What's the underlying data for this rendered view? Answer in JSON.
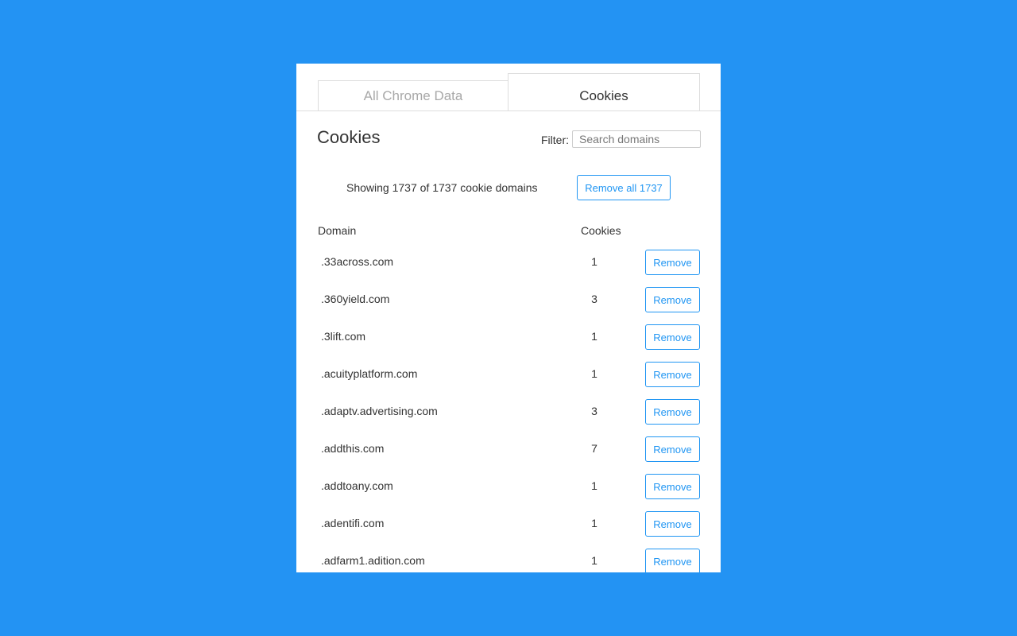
{
  "tabs": [
    {
      "label": "All Chrome Data",
      "active": false
    },
    {
      "label": "Cookies",
      "active": true
    }
  ],
  "header": {
    "title": "Cookies",
    "filter_label": "Filter:",
    "filter_placeholder": "Search domains",
    "filter_value": ""
  },
  "summary": {
    "text": "Showing 1737 of 1737 cookie domains",
    "remove_all_label": "Remove all 1737"
  },
  "table": {
    "columns": [
      "Domain",
      "Cookies"
    ],
    "remove_label": "Remove",
    "rows": [
      {
        "domain": ".33across.com",
        "count": "1"
      },
      {
        "domain": ".360yield.com",
        "count": "3"
      },
      {
        "domain": ".3lift.com",
        "count": "1"
      },
      {
        "domain": ".acuityplatform.com",
        "count": "1"
      },
      {
        "domain": ".adaptv.advertising.com",
        "count": "3"
      },
      {
        "domain": ".addthis.com",
        "count": "7"
      },
      {
        "domain": ".addtoany.com",
        "count": "1"
      },
      {
        "domain": ".adentifi.com",
        "count": "1"
      },
      {
        "domain": ".adfarm1.adition.com",
        "count": "1"
      }
    ]
  },
  "colors": {
    "background": "#2393f3",
    "accent": "#2196f3",
    "panel": "#ffffff",
    "text": "#333333",
    "tab_inactive_text": "#a8a8a8"
  }
}
